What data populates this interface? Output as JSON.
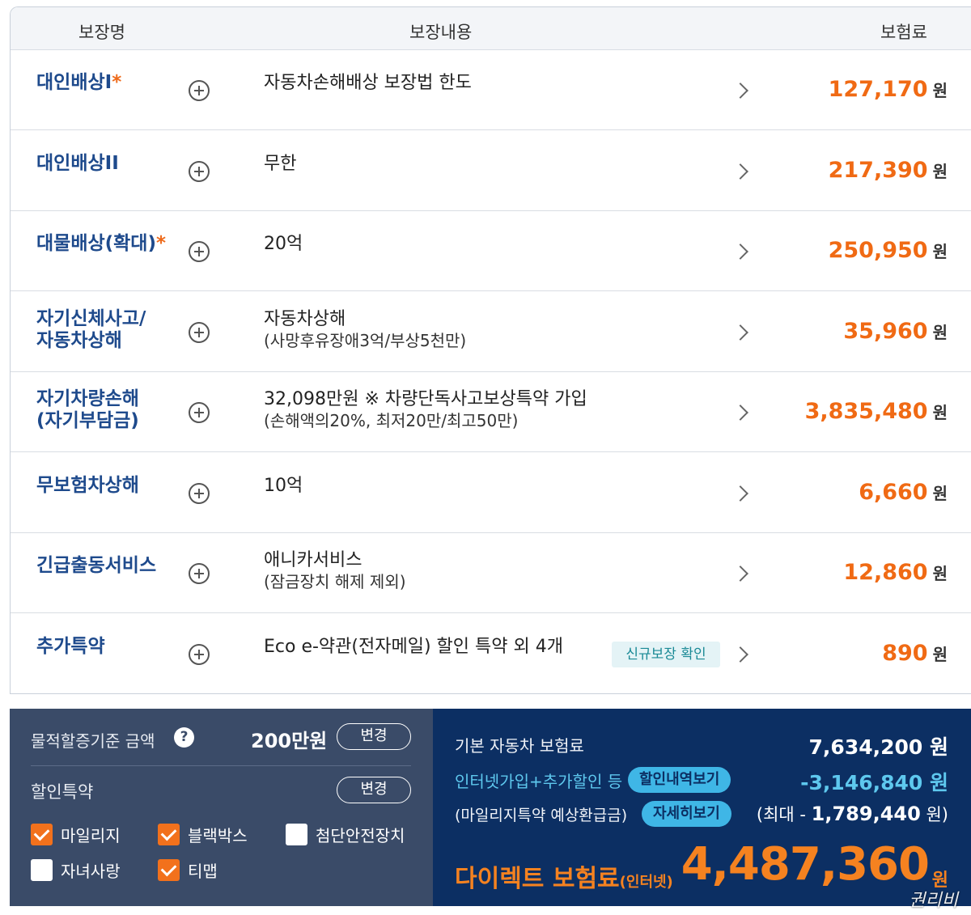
{
  "table": {
    "headers": {
      "name": "보장명",
      "detail": "보장내용",
      "premium": "보험료"
    },
    "won_label": "원",
    "rows": [
      {
        "name": "대인배상I",
        "star": "*",
        "detail": "자동차손해배상 보장법 한도",
        "sub": "",
        "amount": "127,170",
        "badge": ""
      },
      {
        "name": "대인배상II",
        "star": "",
        "detail": "무한",
        "sub": "",
        "amount": "217,390",
        "badge": ""
      },
      {
        "name": "대물배상(확대)",
        "star": "*",
        "detail": "20억",
        "sub": "",
        "amount": "250,950",
        "badge": ""
      },
      {
        "name": "자기신체사고/\n자동차상해",
        "star": "",
        "detail": "자동차상해",
        "sub": "(사망후유장애3억/부상5천만)",
        "amount": "35,960",
        "badge": ""
      },
      {
        "name": "자기차량손해\n(자기부담금)",
        "star": "",
        "detail": "32,098만원 ※ 차량단독사고보상특약 가입",
        "sub": "(손해액의20%, 최저20만/최고50만)",
        "amount": "3,835,480",
        "badge": ""
      },
      {
        "name": "무보험차상해",
        "star": "",
        "detail": "10억",
        "sub": "",
        "amount": "6,660",
        "badge": ""
      },
      {
        "name": "긴급출동서비스",
        "star": "",
        "detail": "애니카서비스",
        "sub": "(잠금장치 해제 제외)",
        "amount": "12,860",
        "badge": ""
      },
      {
        "name": "추가특약",
        "star": "",
        "detail": "Eco e-약관(전자메일) 할인 특약 외 4개",
        "sub": "",
        "amount": "890",
        "badge": "신규보장 확인"
      }
    ]
  },
  "left_panel": {
    "property_label": "물적할증기준 금액",
    "help_icon": "?",
    "property_amount": "200만원",
    "change_label": "변경",
    "discount_label": "할인특약",
    "checkboxes": [
      {
        "label": "마일리지",
        "checked": true
      },
      {
        "label": "블랙박스",
        "checked": true
      },
      {
        "label": "첨단안전장치",
        "checked": false
      },
      {
        "label": "자녀사랑",
        "checked": false
      },
      {
        "label": "티맵",
        "checked": true
      }
    ]
  },
  "right_panel": {
    "base_label": "기본 자동차 보험료",
    "base_amount": "7,634,200 원",
    "discount_label": "인터넷가입+추가할인 등",
    "discount_pill": "할인내역보기",
    "discount_amount": "-3,146,840 원",
    "mileage_label": "(마일리지특약 예상환급금)",
    "mileage_pill": "자세히보기",
    "mileage_prefix": "(최대 - ",
    "mileage_amount": "1,789,440",
    "mileage_suffix": " 원)",
    "direct_label": "다이렉트 보험료",
    "direct_sub": "(인터넷)",
    "total": "4,487,360",
    "total_won": "원"
  },
  "colors": {
    "accent_orange": "#f06a14",
    "navy": "#1e4a8c",
    "panel_dark": "#0c2f63",
    "panel_gray": "#3a4b68",
    "sky": "#5ec8ee"
  },
  "watermark": "권리비"
}
